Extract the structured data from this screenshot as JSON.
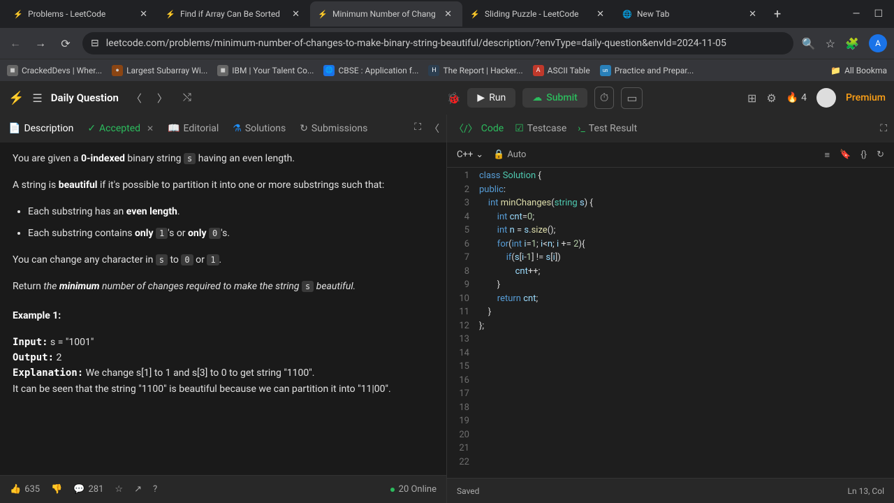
{
  "browser": {
    "tabs": [
      {
        "title": "Problems - LeetCode",
        "favicon": "⚡"
      },
      {
        "title": "Find if Array Can Be Sorted",
        "favicon": "⚡"
      },
      {
        "title": "Minimum Number of Chang",
        "favicon": "⚡",
        "active": true
      },
      {
        "title": "Sliding Puzzle - LeetCode",
        "favicon": "⚡"
      },
      {
        "title": "New Tab",
        "favicon": "🌐"
      }
    ],
    "url": "leetcode.com/problems/minimum-number-of-changes-to-make-binary-string-beautiful/description/?envType=daily-question&envId=2024-11-05",
    "avatar_letter": "A",
    "bookmarks": [
      {
        "label": "CrackedDevs | Wher...",
        "icon": "◼"
      },
      {
        "label": "Largest Subarray Wi...",
        "icon": "●"
      },
      {
        "label": "IBM | Your Talent Co...",
        "icon": "◼"
      },
      {
        "label": "CBSE : Application f...",
        "icon": "🌐"
      },
      {
        "label": "The Report | Hacker...",
        "icon": "H"
      },
      {
        "label": "ASCII Table",
        "icon": "A"
      },
      {
        "label": "Practice and Prepar...",
        "icon": "un"
      }
    ],
    "all_bookmarks": "All Bookma"
  },
  "leetcode": {
    "daily_label": "Daily Question",
    "run_label": "Run",
    "submit_label": "Submit",
    "streak_count": "4",
    "premium_label": "Premium"
  },
  "left_tabs": {
    "description": "Description",
    "accepted": "Accepted",
    "editorial": "Editorial",
    "solutions": "Solutions",
    "submissions": "Submissions"
  },
  "problem": {
    "p1_a": "You are given a ",
    "p1_b": "0-indexed",
    "p1_c": " binary string ",
    "p1_code": "s",
    "p1_d": " having an even length.",
    "p2_a": "A string is ",
    "p2_b": "beautiful",
    "p2_c": " if it's possible to partition it into one or more substrings such that:",
    "li1_a": "Each substring has an ",
    "li1_b": "even length",
    "li1_c": ".",
    "li2_a": "Each substring contains ",
    "li2_b": "only",
    "li2_c1": "1",
    "li2_d": "'s or ",
    "li2_e": "only",
    "li2_c2": "0",
    "li2_f": "'s.",
    "p3_a": "You can change any character in ",
    "p3_c1": "s",
    "p3_b": " to ",
    "p3_c2": "0",
    "p3_c": " or ",
    "p3_c3": "1",
    "p3_d": ".",
    "p4_a": "Return ",
    "p4_b": "the ",
    "p4_c": "minimum",
    "p4_d": " number of changes required to make the string ",
    "p4_code": "s",
    "p4_e": " beautiful.",
    "ex_title": "Example 1:",
    "ex_input_label": "Input:",
    "ex_input_val": " s = \"1001\"",
    "ex_output_label": "Output:",
    "ex_output_val": " 2",
    "ex_expl_label": "Explanation:",
    "ex_expl_val": " We change s[1] to 1 and s[3] to 0 to get string \"1100\".\nIt can be seen that the string \"1100\" is beautiful because we can partition it into \"11|00\"."
  },
  "left_footer": {
    "likes": "635",
    "comments": "281",
    "online": "20 Online"
  },
  "right_tabs": {
    "code": "Code",
    "testcase": "Testcase",
    "testresult": "Test Result"
  },
  "toolbar": {
    "lang": "C++",
    "auto": "Auto"
  },
  "editor": {
    "lines": 22
  },
  "right_footer": {
    "saved": "Saved",
    "cursor": "Ln 13, Col"
  }
}
